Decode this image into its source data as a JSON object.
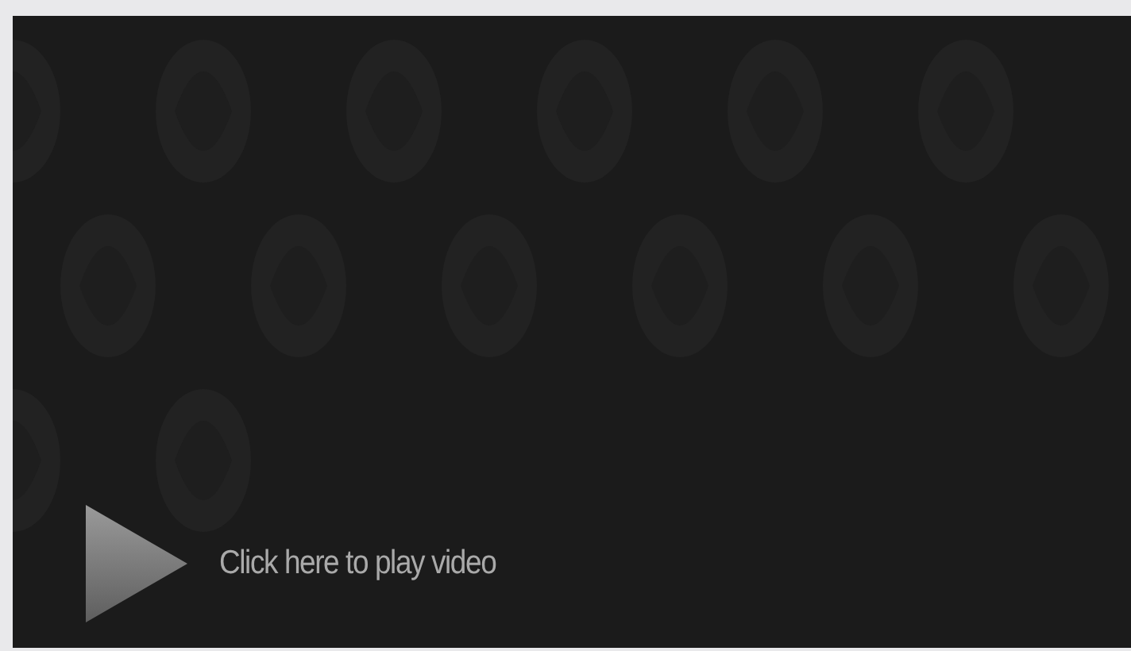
{
  "video": {
    "kind": "picture",
    "prompt": "Click here to play video"
  }
}
